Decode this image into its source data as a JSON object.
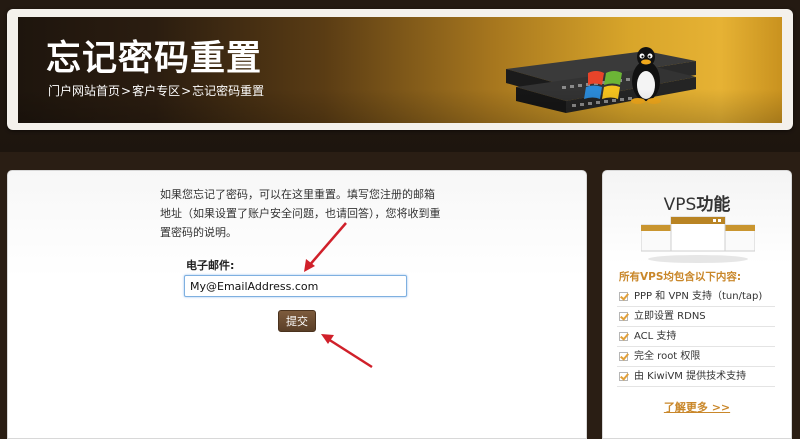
{
  "header": {
    "title": "忘记密码重置",
    "breadcrumb": [
      "门户网站首页",
      "客户专区",
      "忘记密码重置"
    ],
    "breadcrumb_sep": ">"
  },
  "main": {
    "intro": "如果您忘记了密码，可以在这里重置。填写您注册的邮箱地址（如果设置了账户安全问题，也请回答），您将收到重置密码的说明。",
    "email_label": "电子邮件:",
    "email_value": "My@EmailAddress.com",
    "submit_label": "提交"
  },
  "sidebar": {
    "title_prefix": "VPS",
    "title_suffix": "功能",
    "subtitle": "所有VPS均包含以下内容:",
    "features": [
      "PPP 和 VPN 支持（tun/tap)",
      "立即设置 RDNS",
      "ACL 支持",
      "完全 root 权限",
      "由 KiwiVM 提供技术支持"
    ],
    "learn_more": "了解更多 >>"
  },
  "colors": {
    "accent": "#c9872a",
    "button": "#6b4c31",
    "arrow": "#d0202a"
  },
  "icons": [
    "network-switch-icon",
    "windows-logo-icon",
    "tux-penguin-icon",
    "window-stack-icon",
    "checkbox-checked-icon"
  ]
}
